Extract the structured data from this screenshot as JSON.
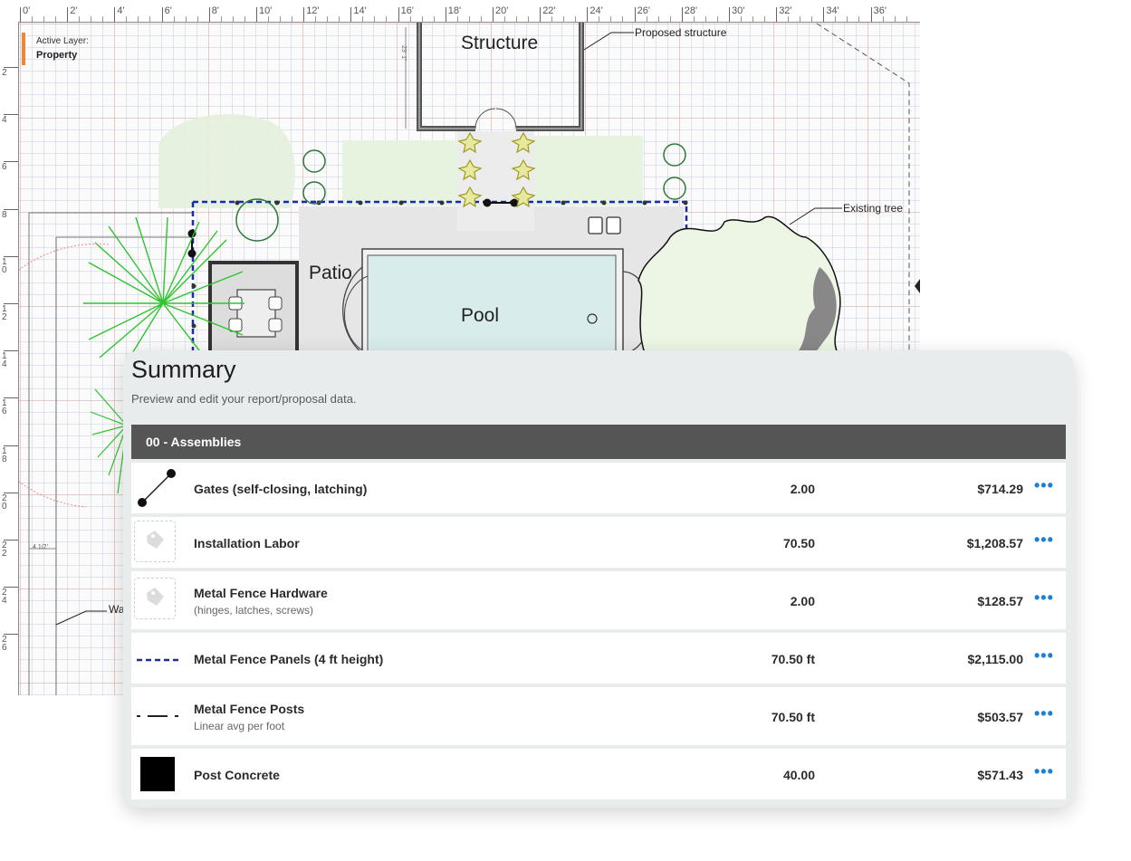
{
  "canvas": {
    "active_layer_caption": "Active Layer:",
    "active_layer_name": "Property",
    "ruler_top_labels": [
      "0'",
      "2'",
      "4'",
      "6'",
      "8'",
      "10'",
      "12'",
      "14'",
      "16'",
      "18'",
      "20'",
      "22'",
      "24'",
      "26'",
      "28'",
      "30'",
      "32'",
      "34'",
      "36'"
    ],
    "ruler_left_labels": [
      "2",
      "4",
      "6",
      "8",
      "10",
      "12",
      "14",
      "16",
      "18",
      "20",
      "22",
      "24",
      "26"
    ],
    "labels": {
      "structure": "Structure",
      "proposed_structure": "Proposed structure",
      "existing_tree": "Existing tree",
      "patio": "Patio",
      "pool": "Pool",
      "wall": "Wa",
      "dim_small": "4 1/2'",
      "dim_vertical": "23' 1\""
    }
  },
  "summary": {
    "title": "Summary",
    "subtitle": "Preview and edit your report/proposal data.",
    "group": "00 - Assemblies",
    "rows": [
      {
        "name": "Gates (self-closing, latching)",
        "note": "",
        "qty": "2.00",
        "amount": "$714.29",
        "icon": "gate-icon"
      },
      {
        "name": "Installation Labor",
        "note": "",
        "qty": "70.50",
        "amount": "$1,208.57",
        "icon": "tag-placeholder-icon"
      },
      {
        "name": "Metal Fence Hardware",
        "note": "(hinges, latches, screws)",
        "qty": "2.00",
        "amount": "$128.57",
        "icon": "tag-placeholder-icon"
      },
      {
        "name": "Metal Fence Panels (4 ft height)",
        "note": "",
        "qty": "70.50 ft",
        "amount": "$2,115.00",
        "icon": "dashed-line-icon"
      },
      {
        "name": "Metal Fence Posts",
        "note": "Linear avg per foot",
        "qty": "70.50 ft",
        "amount": "$503.57",
        "icon": "dash-dot-line-icon"
      },
      {
        "name": "Post Concrete",
        "note": "",
        "qty": "40.00",
        "amount": "$571.43",
        "icon": "black-square-icon"
      }
    ],
    "more_label": "•••"
  },
  "colors": {
    "accent_layer": "#e8883a",
    "fence_line": "#1a2aa8",
    "pool_fill": "#d8ecec",
    "palm_green": "#2ec52e",
    "more_blue": "#1a7fd6",
    "header_dark": "#555555"
  }
}
